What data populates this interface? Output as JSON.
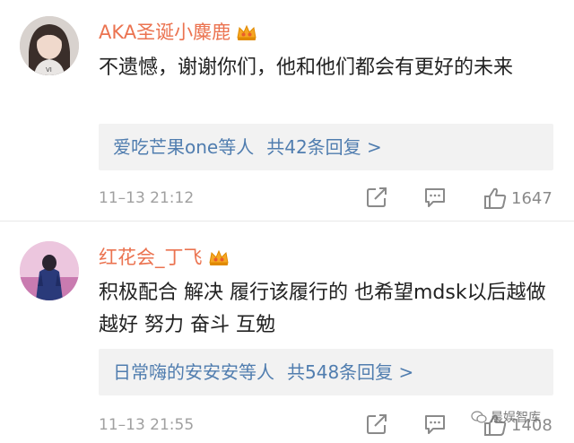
{
  "comments": [
    {
      "username": "AKA圣诞小麋鹿",
      "text": "不遗憾，谢谢你们，他和他们都会有更好的未来",
      "reply_users": "爱吃芒果one等人",
      "reply_count": "共42条回复 >",
      "time": "11–13 21:12",
      "likes": "1647"
    },
    {
      "username": "红花会_丁飞",
      "text": "积极配合 解决 履行该履行的 也希望mdsk以后越做越好 努力 奋斗 互勉",
      "reply_users": "日常嗨的安安安等人",
      "reply_count": "共548条回复 >",
      "time": "11–13 21:55",
      "likes": "1408"
    }
  ],
  "watermark": "晨娱智库",
  "colors": {
    "username": "#eb7350",
    "link": "#507daf",
    "meta": "#a0a0a0",
    "reply_bg": "#f2f2f2"
  },
  "icons": {
    "member_badge": "crown-badge-icon",
    "share": "share-icon",
    "comment": "comment-icon",
    "like": "thumbs-up-icon"
  }
}
